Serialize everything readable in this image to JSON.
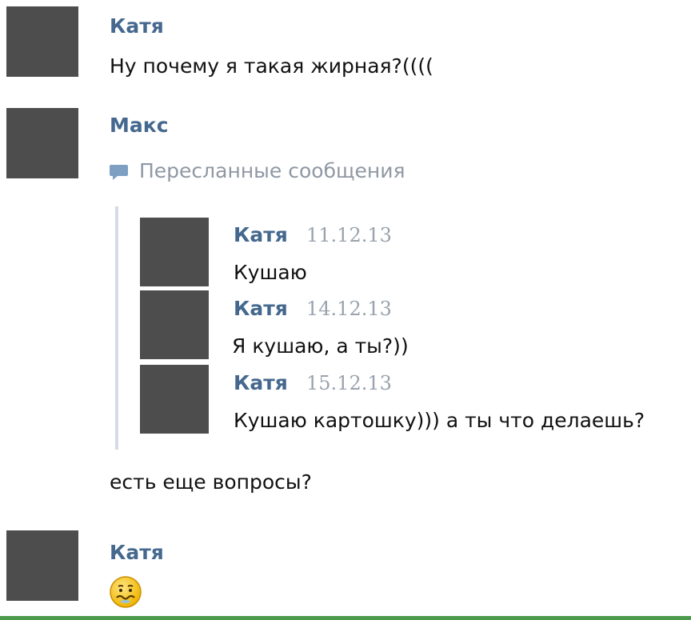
{
  "messages": [
    {
      "author": "Катя",
      "text": "Ну почему я такая жирная?(((("
    },
    {
      "author": "Макс",
      "forwarded_label": "Пересланные сообщения",
      "forwarded": [
        {
          "author": "Катя",
          "date": "11.12.13",
          "text": "Кушаю"
        },
        {
          "author": "Катя",
          "date": "14.12.13",
          "text": "Я кушаю, а ты?))"
        },
        {
          "author": "Катя",
          "date": "15.12.13",
          "text": "Кушаю картошку))) а ты что делаешь?"
        }
      ],
      "text": "есть еще вопросы?"
    },
    {
      "author": "Катя",
      "emoji": "smiley-emoji"
    }
  ],
  "colors": {
    "author_link": "#45688e",
    "date_text": "#9aa3ad",
    "forward_line": "#d3dbe4",
    "avatar_placeholder": "#4d4d4d"
  },
  "icons": {
    "forwarded": "speech-bubble-icon"
  }
}
